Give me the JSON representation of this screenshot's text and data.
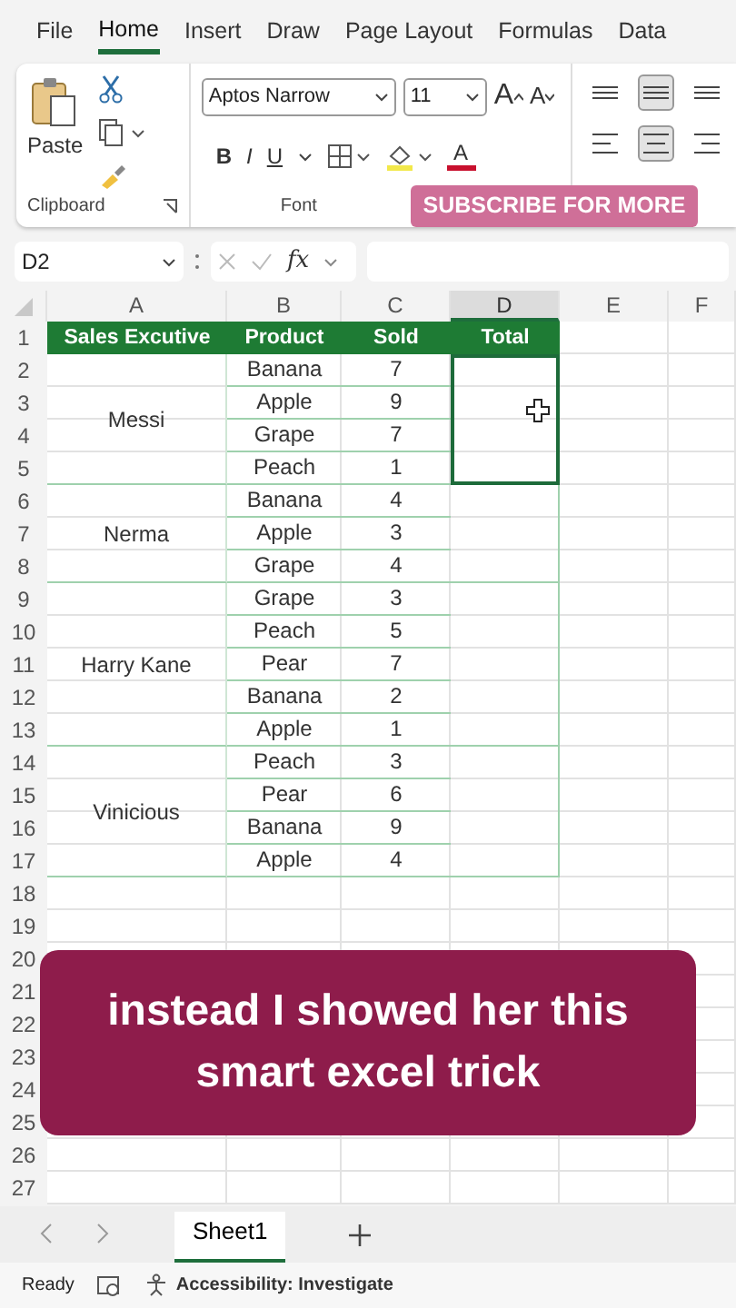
{
  "ribbon_tabs": [
    {
      "label": "File",
      "selected": false
    },
    {
      "label": "Home",
      "selected": true
    },
    {
      "label": "Insert",
      "selected": false
    },
    {
      "label": "Draw",
      "selected": false
    },
    {
      "label": "Page Layout",
      "selected": false
    },
    {
      "label": "Formulas",
      "selected": false
    },
    {
      "label": "Data",
      "selected": false
    }
  ],
  "ribbon": {
    "paste_label": "Paste",
    "font_name": "Aptos Narrow",
    "font_size": "11",
    "grow_font": "A",
    "shrink_font": "A",
    "bold": "B",
    "italic": "I",
    "underline": "U",
    "font_color": "A",
    "clipboard_label": "Clipboard",
    "font_label": "Font",
    "alignment": [
      {
        "kind": "top",
        "selected": false
      },
      {
        "kind": "middle",
        "selected": true
      },
      {
        "kind": "bottom",
        "selected": false
      },
      {
        "kind": "left",
        "selected": false
      },
      {
        "kind": "center",
        "selected": true
      },
      {
        "kind": "right",
        "selected": false
      }
    ]
  },
  "promo_badge": "SUBSCRIBE FOR MORE",
  "formula_bar": {
    "name_box": "D2",
    "fx": "fx"
  },
  "sheet": {
    "columns": [
      {
        "label": "A",
        "selected": false
      },
      {
        "label": "B",
        "selected": false
      },
      {
        "label": "C",
        "selected": false
      },
      {
        "label": "D",
        "selected": true
      },
      {
        "label": "E",
        "selected": false
      },
      {
        "label": "F",
        "selected": false
      }
    ],
    "row_numbers": [
      "1",
      "2",
      "3",
      "4",
      "5",
      "6",
      "7",
      "8",
      "9",
      "10",
      "11",
      "12",
      "13",
      "14",
      "15",
      "16",
      "17",
      "18",
      "19",
      "20",
      "21",
      "22",
      "23",
      "24",
      "25",
      "26",
      "27"
    ],
    "header_row": [
      "Sales Excutive",
      "Product",
      "Sold",
      "Total"
    ],
    "groups": [
      {
        "executive": "Messi",
        "selected": true,
        "items": [
          {
            "product": "Banana",
            "sold": "7"
          },
          {
            "product": "Apple",
            "sold": "9"
          },
          {
            "product": "Grape",
            "sold": "7"
          },
          {
            "product": "Peach",
            "sold": "1"
          }
        ]
      },
      {
        "executive": "Nerma",
        "selected": false,
        "items": [
          {
            "product": "Banana",
            "sold": "4"
          },
          {
            "product": "Apple",
            "sold": "3"
          },
          {
            "product": "Grape",
            "sold": "4"
          }
        ]
      },
      {
        "executive": "Harry Kane",
        "selected": false,
        "items": [
          {
            "product": "Grape",
            "sold": "3"
          },
          {
            "product": "Peach",
            "sold": "5"
          },
          {
            "product": "Pear",
            "sold": "7"
          },
          {
            "product": "Banana",
            "sold": "2"
          },
          {
            "product": "Apple",
            "sold": "1"
          }
        ]
      },
      {
        "executive": "Vinicious",
        "selected": false,
        "items": [
          {
            "product": "Peach",
            "sold": "3"
          },
          {
            "product": "Pear",
            "sold": "6"
          },
          {
            "product": "Banana",
            "sold": "9"
          },
          {
            "product": "Apple",
            "sold": "4"
          }
        ]
      }
    ]
  },
  "caption": "instead I showed her this smart excel trick",
  "sheet_tabs": [
    {
      "label": "Sheet1",
      "selected": true
    }
  ],
  "status_bar": {
    "ready": "Ready",
    "accessibility": "Accessibility: Investigate"
  }
}
